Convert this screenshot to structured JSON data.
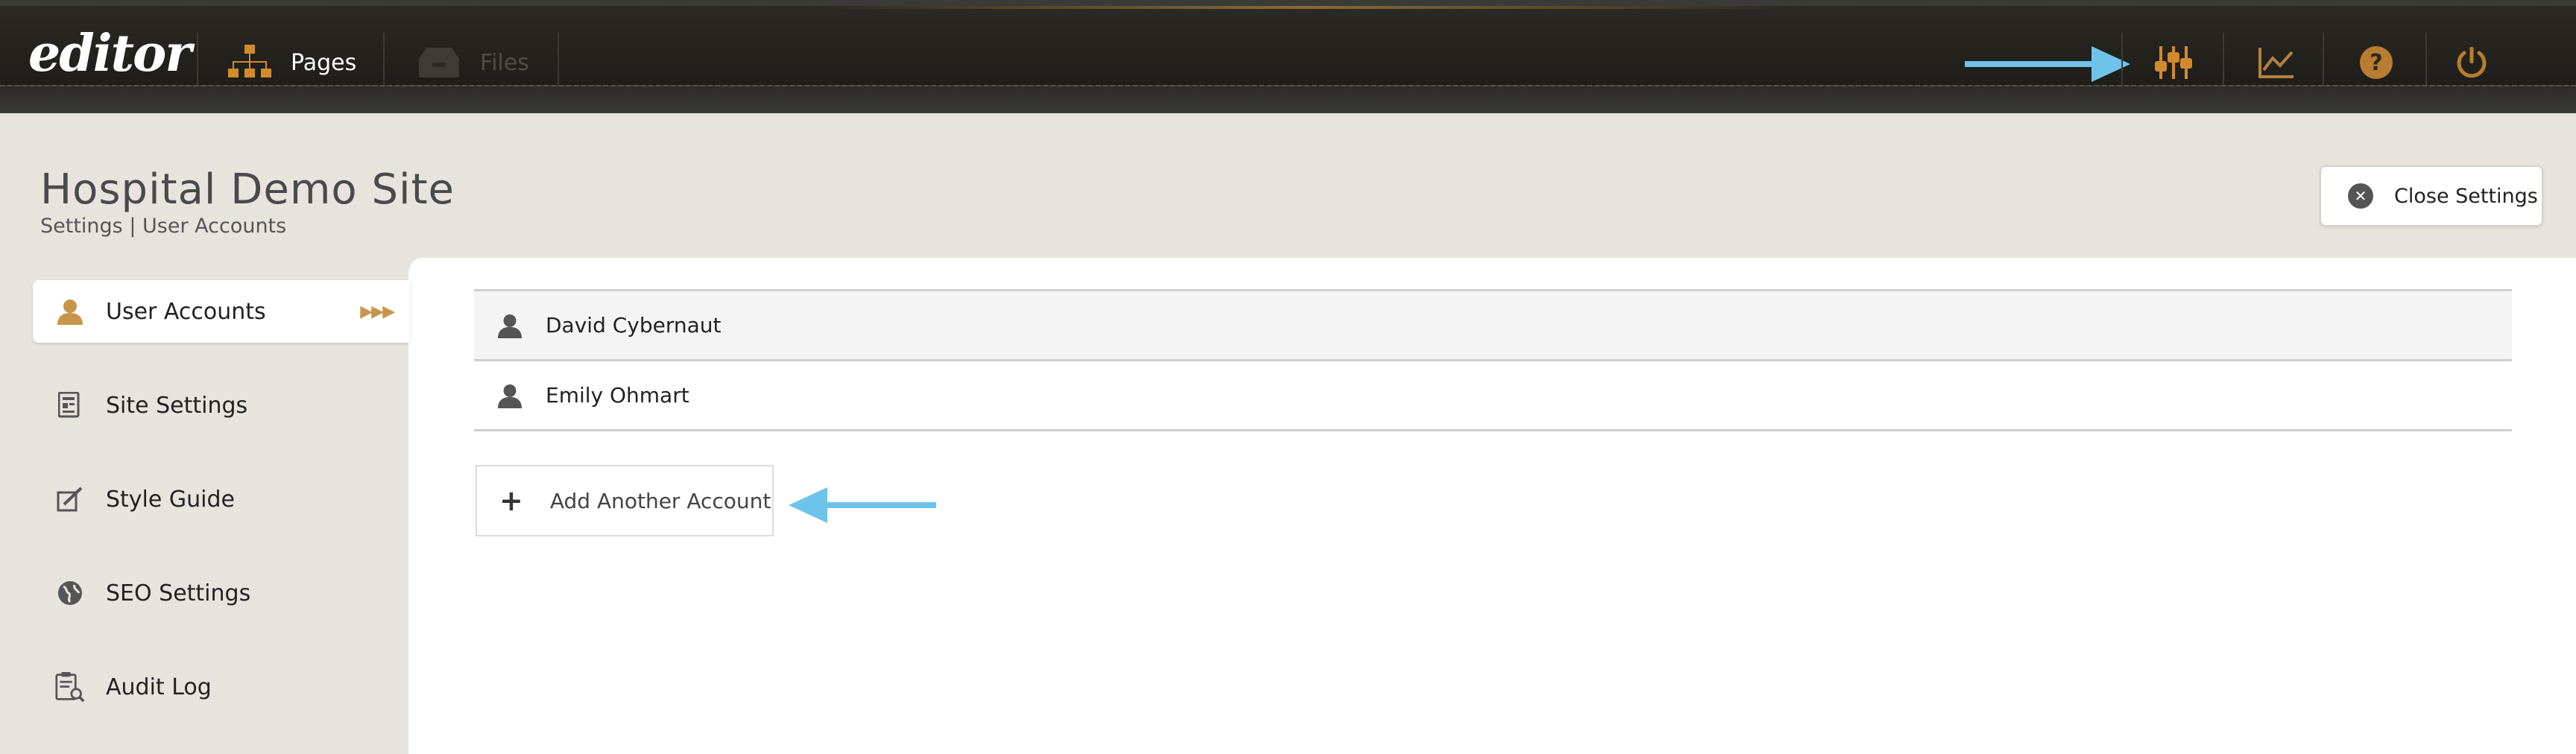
{
  "app": {
    "logo": "editor"
  },
  "topbar": {
    "nav": [
      {
        "label": "Pages",
        "icon": "sitemap-icon",
        "enabled": true
      },
      {
        "label": "Files",
        "icon": "files-icon",
        "enabled": false
      }
    ],
    "tools": [
      "settings-sliders-icon",
      "analytics-chart-icon",
      "help-icon",
      "power-icon"
    ]
  },
  "page": {
    "title": "Hospital Demo Site",
    "breadcrumb": "Settings | User Accounts",
    "close_label": "Close Settings"
  },
  "sidebar": {
    "items": [
      {
        "label": "User Accounts",
        "icon": "user-icon",
        "active": true
      },
      {
        "label": "Site Settings",
        "icon": "site-settings-icon",
        "active": false
      },
      {
        "label": "Style Guide",
        "icon": "style-guide-icon",
        "active": false
      },
      {
        "label": "SEO Settings",
        "icon": "globe-icon",
        "active": false
      },
      {
        "label": "Audit Log",
        "icon": "audit-clipboard-icon",
        "active": false
      }
    ],
    "active_marker": "▶▶▶"
  },
  "accounts": {
    "rows": [
      {
        "name": "David Cybernaut"
      },
      {
        "name": "Emily Ohmart"
      }
    ],
    "add_label": "Add Another Account",
    "add_symbol": "+"
  },
  "colors": {
    "accent": "#c9954d",
    "annotation_arrow": "#6ec3ea",
    "topbar": "#1f1e1a",
    "background": "#e6e4dd"
  }
}
